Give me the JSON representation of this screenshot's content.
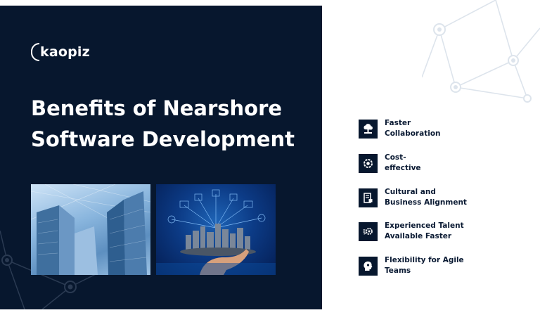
{
  "brand": {
    "name": "kaopiz"
  },
  "hero": {
    "title_line1": "Benefits of Nearshore",
    "title_line2": "Software Development"
  },
  "images": [
    {
      "name": "skyscrapers-photo"
    },
    {
      "name": "city-on-hand-photo"
    }
  ],
  "benefits": [
    {
      "line1": "Faster",
      "line2": "Collaboration",
      "icon": "cloud-network-icon"
    },
    {
      "line1": "Cost-",
      "line2": "effective",
      "icon": "gear-icon"
    },
    {
      "line1": "Cultural and",
      "line2": "Business Alignment",
      "icon": "document-lock-icon"
    },
    {
      "line1": "Experienced Talent",
      "line2": "Available Faster",
      "icon": "idea-gear-icon"
    },
    {
      "line1": "Flexibility for Agile",
      "line2": "Teams",
      "icon": "head-gear-icon"
    }
  ],
  "colors": {
    "navy": "#07172e",
    "white": "#ffffff",
    "text_dark": "#0a1a33"
  }
}
